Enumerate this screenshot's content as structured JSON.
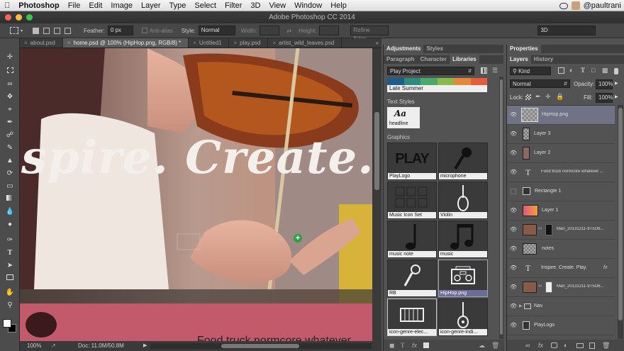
{
  "menubar": {
    "apple": "",
    "app": "Photoshop",
    "items": [
      "File",
      "Edit",
      "Image",
      "Layer",
      "Type",
      "Select",
      "Filter",
      "3D",
      "View",
      "Window",
      "Help"
    ],
    "user": "@paultrani"
  },
  "window": {
    "title": "Adobe Photoshop CC 2014"
  },
  "options": {
    "feather_label": "Feather:",
    "feather_value": "0 px",
    "antialias_label": "Anti-alias",
    "style_label": "Style:",
    "style_value": "Normal",
    "width_label": "Width:",
    "height_label": "Height:",
    "refine_edge": "Refine Edge...",
    "mode_3d": "3D"
  },
  "doc_tabs": [
    {
      "label": "about.psd"
    },
    {
      "label": "home.psd @ 100% (HipHop.png, RGB/8) *"
    },
    {
      "label": "Untitled1"
    },
    {
      "label": "play.psd"
    },
    {
      "label": "artist_wild_leaves.psd"
    }
  ],
  "canvas": {
    "headline": "spire. Create.",
    "footer_text": "Food truck normcore whatever"
  },
  "status": {
    "zoom": "100%",
    "doc": "Doc: 11.0M/50.8M"
  },
  "libraries": {
    "tabs": [
      "Adjustments",
      "Styles"
    ],
    "tabs2": [
      "Paragraph",
      "Character",
      "Libraries"
    ],
    "library_name": "Play Project",
    "color_theme_name": "Late Summer",
    "colors": [
      "#1f5c8a",
      "#2f8b7b",
      "#4aa86b",
      "#8bb84a",
      "#e08a3a",
      "#e35c3b"
    ],
    "text_styles_label": "Text Styles",
    "text_style": {
      "sample": "Aa",
      "name": "headline"
    },
    "graphics_label": "Graphics",
    "graphics": [
      {
        "name": "PlayLogo",
        "icon": "play-logo-icon"
      },
      {
        "name": "microphone",
        "icon": "microphone-icon"
      },
      {
        "name": "Music Icon Set",
        "icon": "music-icon-set-icon"
      },
      {
        "name": "Violin",
        "icon": "violin-icon"
      },
      {
        "name": "music note",
        "icon": "music-note-icon"
      },
      {
        "name": "music",
        "icon": "music-notes-icon"
      },
      {
        "name": "RB",
        "icon": "microphone-icon"
      },
      {
        "name": "HipHop.png",
        "icon": "boombox-icon"
      },
      {
        "name": "icon-genre-elec...",
        "icon": "keyboard-icon"
      },
      {
        "name": "icon-genre-indi...",
        "icon": "guitar-icon"
      }
    ]
  },
  "layers": {
    "tabs_top": [
      "Properties"
    ],
    "tabs": [
      "Layers",
      "History"
    ],
    "kind": "Kind",
    "blend_mode": "Normal",
    "opacity_label": "Opacity:",
    "opacity": "100%",
    "lock_label": "Lock:",
    "fill_label": "Fill:",
    "fill": "100%",
    "items": [
      {
        "name": "HipHop.png",
        "selected": true,
        "type": "image"
      },
      {
        "name": "Layer 3",
        "type": "image"
      },
      {
        "name": "Layer 2",
        "type": "image"
      },
      {
        "name": "Food truck normcore whatever ...",
        "type": "text"
      },
      {
        "name": "Rectangle 1",
        "type": "shape",
        "hidden": true
      },
      {
        "name": "Layer 1",
        "type": "gradient"
      },
      {
        "name": "Mari_20131211-9T5O6...",
        "type": "masked"
      },
      {
        "name": "notes",
        "type": "image"
      },
      {
        "name": "Inspire. Create. Play.",
        "type": "text",
        "fx": "fx"
      },
      {
        "name": "Mari_20131211-9T5O6...",
        "type": "masked2"
      },
      {
        "name": "Nav",
        "type": "group"
      },
      {
        "name": "PlayLogo",
        "type": "smart"
      }
    ]
  }
}
